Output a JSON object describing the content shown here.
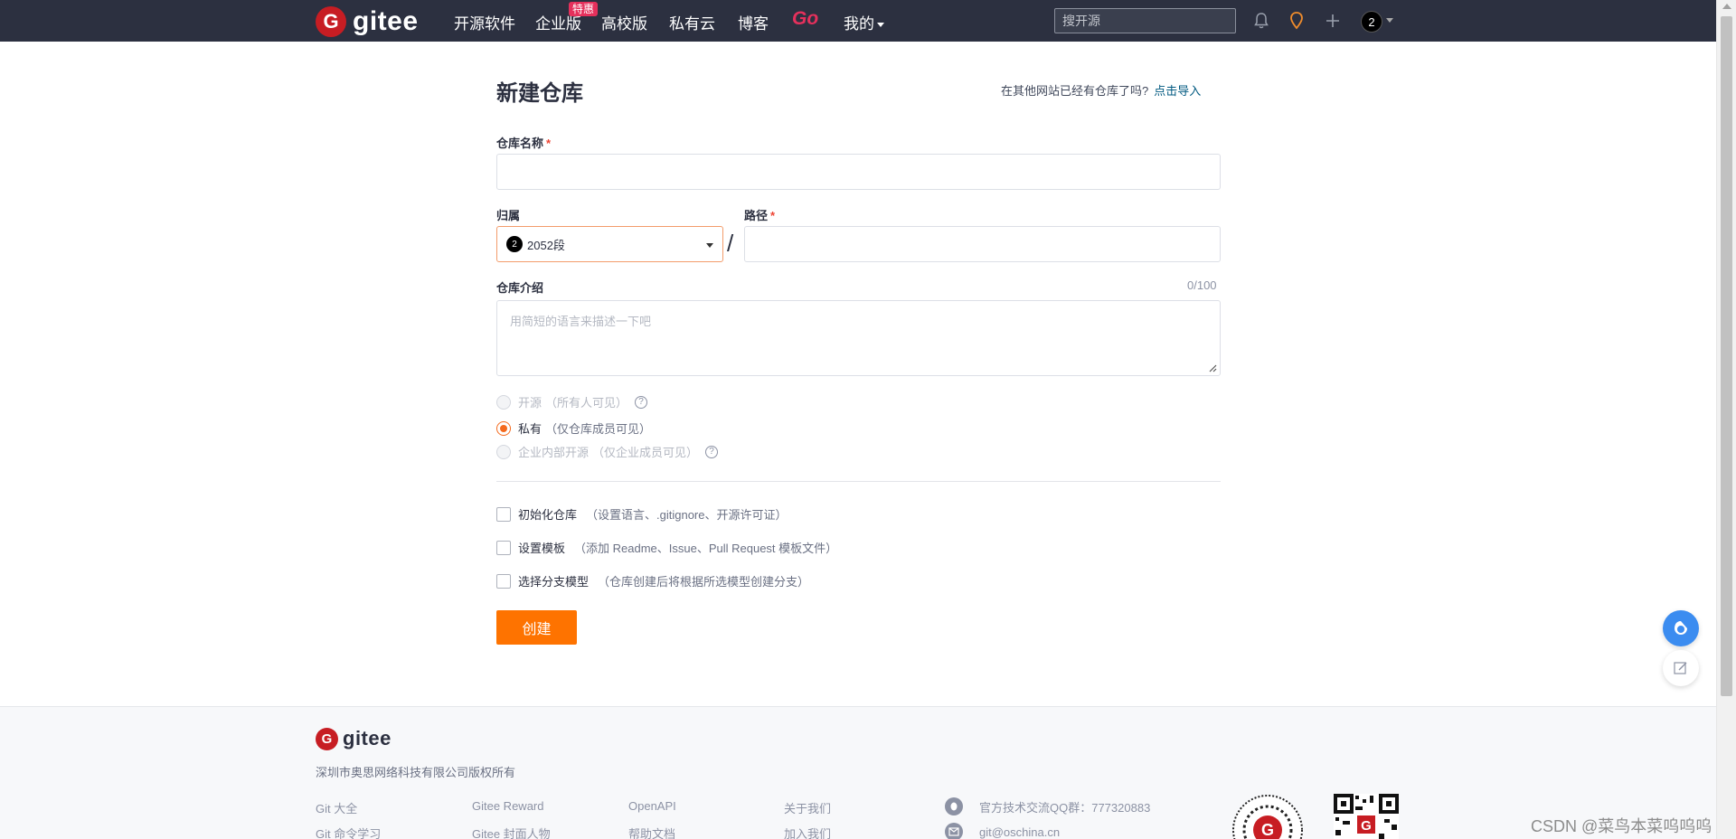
{
  "nav": {
    "logo_text": "gitee",
    "logo_letter": "G",
    "items": [
      {
        "label": "开源软件"
      },
      {
        "label": "企业版"
      },
      {
        "label": "高校版"
      },
      {
        "label": "私有云"
      },
      {
        "label": "博客"
      }
    ],
    "hot_badge": "特惠",
    "go_label": "Go",
    "mine_label": "我的",
    "search_placeholder": "搜开源",
    "avatar_text": "2",
    "icons": [
      "bell-icon",
      "location-pin-icon",
      "plus-icon"
    ]
  },
  "form": {
    "title": "新建仓库",
    "import_tip": "在其他网站已经有仓库了吗?",
    "import_link": "点击导入",
    "repo_name_label": "仓库名称",
    "required_mark": "*",
    "repo_name_value": "",
    "owner_label": "归属",
    "owner_avatar_text": "2",
    "owner_name": "2052段",
    "path_label": "路径",
    "path_value": "",
    "slash": "/",
    "desc_label": "仓库介绍",
    "desc_counter": "0/100",
    "desc_placeholder": "用简短的语言来描述一下吧",
    "visibility": [
      {
        "label": "开源",
        "hint": "（所有人可见）",
        "checked": false,
        "disabled": true,
        "help": true
      },
      {
        "label": "私有",
        "hint": "（仅仓库成员可见）",
        "checked": true,
        "disabled": false,
        "help": false
      },
      {
        "label": "企业内部开源",
        "hint": "（仅企业成员可见）",
        "checked": false,
        "disabled": true,
        "help": true
      }
    ],
    "options": [
      {
        "label": "初始化仓库",
        "hint": "（设置语言、.gitignore、开源许可证）"
      },
      {
        "label": "设置模板",
        "hint": "（添加 Readme、Issue、Pull Request 模板文件）"
      },
      {
        "label": "选择分支模型",
        "hint": "（仓库创建后将根据所选模型创建分支）"
      }
    ],
    "submit_label": "创建",
    "accent_color": "#fe7300"
  },
  "footer": {
    "logo_text": "gitee",
    "copyright": "深圳市奥思网络科技有限公司版权所有",
    "links": [
      [
        "Git 大全",
        "Git 命令学习"
      ],
      [
        "Gitee Reward",
        "Gitee 封面人物"
      ],
      [
        "OpenAPI",
        "帮助文档"
      ],
      [
        "关于我们",
        "加入我们"
      ]
    ],
    "qq_group": "官方技术交流QQ群：777320883",
    "email": "git@oschina.cn"
  },
  "watermark": "CSDN @菜鸟本菜呜呜呜"
}
